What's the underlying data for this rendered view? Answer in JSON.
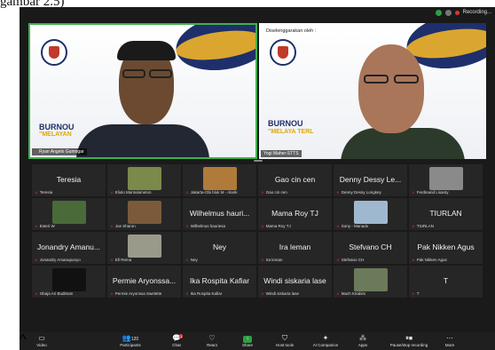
{
  "caption": "gambar 2.5)",
  "topbar": {
    "recording": "Recording..."
  },
  "speakers": [
    {
      "name": "Ryan Angelo Gumogar",
      "bg_title": "BURNOU",
      "bg_subtitle": "\"MELAYAN"
    },
    {
      "name": "Yogi Maher-STTS",
      "bg_by": "Diselenggarakan oleh :",
      "bg_title": "BURNOU",
      "bg_subtitle": "\"MELAYA    TERL"
    }
  ],
  "participants": [
    {
      "display": "Teresia",
      "label": "Teresia"
    },
    {
      "display": "",
      "label": "Eliolo Mantulameton",
      "thumb": "#7a8a4a"
    },
    {
      "display": "",
      "label": "Jakarta-Obi blok M - Alarik",
      "thumb": "#b07a3a"
    },
    {
      "display": "Gao cin cen",
      "label": "Gao cin cen"
    },
    {
      "display": "Denny Dessy Le...",
      "label": "Denny Dessy Longkey"
    },
    {
      "display": "",
      "label": "Ferdinand Lisanty",
      "thumb": "#8a8a8a"
    },
    {
      "display": "",
      "label": "Esteri W",
      "thumb": "#4a6a3a"
    },
    {
      "display": "",
      "label": "Joe Sharon",
      "thumb": "#7a5a3a"
    },
    {
      "display": "Wilhelmus hauri...",
      "label": "Wilhelmus hauriesa"
    },
    {
      "display": "Mama Roy TJ",
      "label": "Mama Roy TJ"
    },
    {
      "display": "",
      "label": "Sony - Manado",
      "thumb": "#9fb8cf"
    },
    {
      "display": "TIURLAN",
      "label": "TIURLAN"
    },
    {
      "display": "Jonandry Amanu...",
      "label": "Jonandry Amanupunyo"
    },
    {
      "display": "",
      "label": "Efi Rema",
      "thumb": "#9a9a8a"
    },
    {
      "display": "Ney",
      "label": "Ney"
    },
    {
      "display": "Ira leman",
      "label": "Ira leman"
    },
    {
      "display": "Stefvano CH",
      "label": "Stefvano CH"
    },
    {
      "display": "Pak Nikken Agus",
      "label": "Pak Nikken Agus"
    },
    {
      "display": "",
      "label": "Obaja Ari Budiman",
      "thumb": "#111111"
    },
    {
      "display": "Permie Aryonssa...",
      "label": "Permie Aryonssa Swelette"
    },
    {
      "display": "Ika Rospita Kafiar",
      "label": "Ika Rospita Kafiar"
    },
    {
      "display": "Windi siskaria lase",
      "label": "Windi siskaria lase"
    },
    {
      "display": "",
      "label": "Mach Kirabim",
      "thumb": "#6a7a5a"
    },
    {
      "display": "T",
      "label": "T"
    }
  ],
  "toolbar": {
    "video": "Video",
    "participants": "Participants",
    "participant_count": "120",
    "chat": "Chat",
    "chat_badge": "1",
    "react": "React",
    "share": "Share",
    "host_tools": "Host tools",
    "ai_companion": "AI Companion",
    "apps": "Apps",
    "pause_stop": "Pause/stop recording",
    "more": "More"
  }
}
